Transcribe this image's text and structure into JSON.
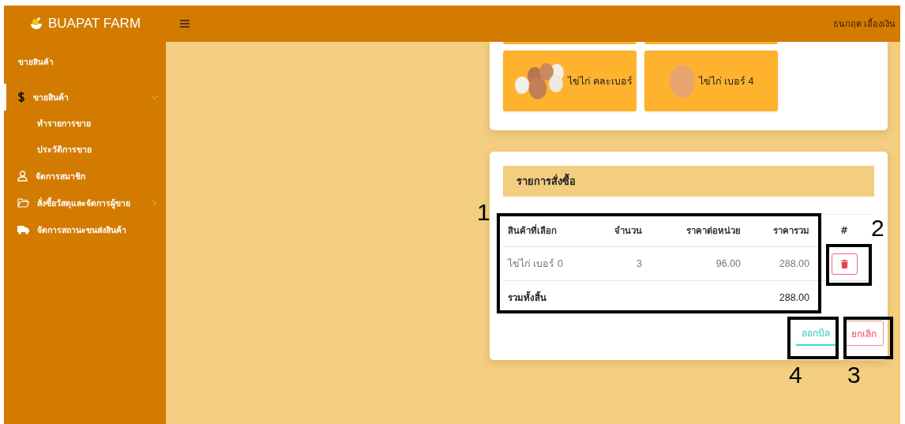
{
  "header": {
    "brand": "BUAPAT FARM",
    "user": "ธนกฤต เอื้องเงิน"
  },
  "sidebar": {
    "section": "ขายสินค้า",
    "items": [
      {
        "kind": "dollar",
        "label": "ขายสินค้า",
        "selected": true,
        "expanded": true,
        "children": [
          {
            "label": "ทำรายการขาย",
            "selected": false
          },
          {
            "label": "ประวัติการขาย",
            "selected": false
          }
        ]
      },
      {
        "kind": "user",
        "label": "จัดการสมาชิก",
        "selected": false
      },
      {
        "kind": "folder",
        "label": "สั่งซื้อวัสดุและจัดการผู้ขาย",
        "selected": false,
        "expanded": false
      },
      {
        "kind": "truck",
        "label": "จัดการสถานะขนส่งสินค้า",
        "selected": false
      }
    ]
  },
  "products": [
    {
      "kind": "mixed",
      "name": "ไข่ไก่ คละเบอร์"
    },
    {
      "kind": "single",
      "name": "ไข่ไก่ เบอร์ 4"
    }
  ],
  "order": {
    "title": "รายการสั่งซื้อ",
    "columns": [
      "สินค้าที่เลือก",
      "จำนวน",
      "ราคาต่อหน่วย",
      "ราคารวม",
      "#"
    ],
    "rows": [
      {
        "product": "ไข่ไก่ เบอร์ 0",
        "quantity": "3",
        "unit_price": "96.00",
        "total": "288.00"
      }
    ],
    "total_label": "รวมทั้งสิ้น",
    "total_value": "288.00",
    "buttons": [
      {
        "kind": "bill",
        "label": "ออกบิล"
      },
      {
        "kind": "cancel",
        "label": "ยกเลิก"
      }
    ]
  },
  "annotations": [
    {
      "kind": "table",
      "label": "1"
    },
    {
      "kind": "delete",
      "label": "2"
    },
    {
      "kind": "cancel",
      "label": "3"
    },
    {
      "kind": "bill",
      "label": "4"
    }
  ]
}
